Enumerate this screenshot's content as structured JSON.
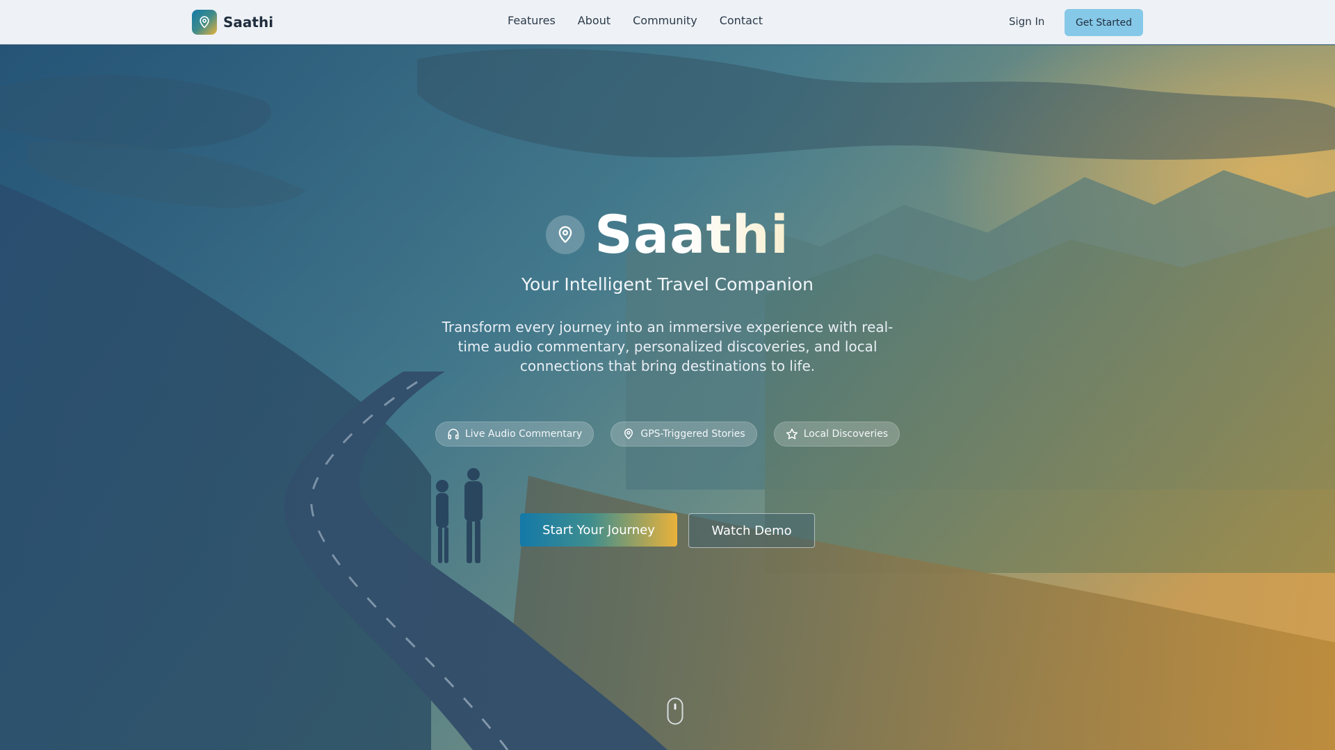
{
  "brand": {
    "name": "Saathi",
    "logo_icon": "map-pin-icon"
  },
  "nav": {
    "links": [
      "Features",
      "About",
      "Community",
      "Contact"
    ],
    "sign_in": "Sign In",
    "get_started": "Get Started"
  },
  "hero": {
    "title": "Saathi",
    "title_icon": "map-pin-icon",
    "subtitle": "Your Intelligent Travel Companion",
    "description": "Transform every journey into an immersive experience with real-time audio commentary, personalized discoveries, and local connections that bring destinations to life.",
    "features": [
      {
        "label": "Live Audio Commentary",
        "icon": "headphones-icon"
      },
      {
        "label": "GPS-Triggered Stories",
        "icon": "map-pin-icon"
      },
      {
        "label": "Local Discoveries",
        "icon": "star-icon"
      }
    ],
    "primary_cta": "Start Your Journey",
    "secondary_cta": "Watch Demo",
    "scroll_icon": "mouse-scroll-icon"
  },
  "colors": {
    "brand_blue": "#1479a8",
    "brand_gold": "#eab23a",
    "nav_bg": "#eef2f6",
    "get_started_bg": "#86c8e8"
  }
}
